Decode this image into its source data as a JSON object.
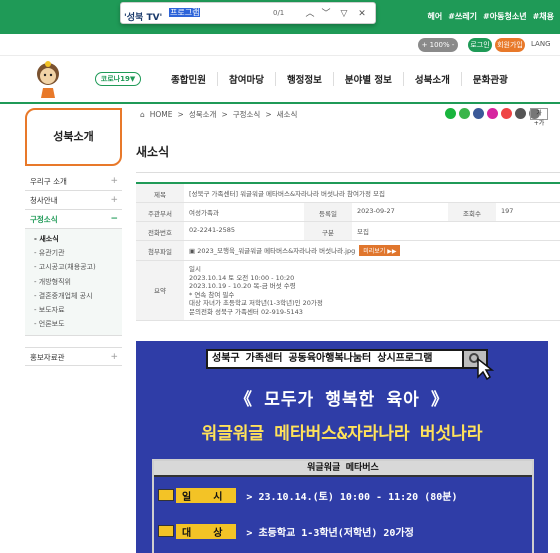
{
  "findbar": {
    "query": "프로그램",
    "count": "0/1",
    "brand": "'성북 TV'"
  },
  "topbar": {
    "tags": [
      "헤어",
      "#쓰레기",
      "#아동청소년",
      "#채용"
    ]
  },
  "subbar": {
    "zoom": "+ 100% -",
    "login": "로그인",
    "join": "회원가입",
    "lang": "LANG"
  },
  "header": {
    "corona": "코로나19▼",
    "nav": [
      "종합민원",
      "참여마당",
      "행정정보",
      "분야별 정보",
      "성북소개",
      "문화관광"
    ]
  },
  "sidebar": {
    "title": "성북소개",
    "items": [
      {
        "label": "우리구 소개",
        "mark": "+"
      },
      {
        "label": "청사안내",
        "mark": "+"
      },
      {
        "label": "구정소식",
        "mark": "−"
      }
    ],
    "sub": [
      "새소식",
      "유관기관",
      "고시공고(채용공고)",
      "개방형직위",
      "결혼중개업체 공시",
      "보도자료",
      "언론보도"
    ],
    "last": {
      "label": "홍보자료관",
      "mark": "+"
    }
  },
  "breadcrumb": [
    "HOME",
    "성북소개",
    "구정소식",
    "새소식"
  ],
  "breadcrumb_sep": ">",
  "page_title": "새소식",
  "gaga": "가+가",
  "detail": {
    "subject_label": "제목",
    "subject": "[성북구 가족센터] 워글워글 메타버스&자라나라 버섯나라 참여가정 모집",
    "dept_label": "주관부서",
    "dept": "여성가족과",
    "reg_label": "등록일",
    "reg": "2023-09-27",
    "views_label": "조회수",
    "views": "197",
    "phone_label": "전화번호",
    "phone": "02-2241-2585",
    "type_label": "구분",
    "type": "모집",
    "file_label": "첨부파일",
    "file": "2023_모행육_워글워글 메타버스&자라나라 버섯나라.jpg",
    "preview": "미리보기 ▶▶",
    "summary_label": "요약",
    "summary": [
      "일시",
      "2023.10.14 토 오전 10:00 - 10:20",
      "2023.10.19 - 10.20 목-금 버섯 수령",
      "* 연속 참여 필수",
      "대상 자녀가 초등학교 저학년(1-3학년)인 20가정",
      "문의전화  성북구 가족센터  02-919-5143"
    ]
  },
  "poster": {
    "search_text": "성북구 가족센터 공동육아행복나눔터 상시프로그램",
    "headline1": "《 모두가 행복한 육아 》",
    "headline2": "워글워글 메타버스&자라나라 버섯나라",
    "window_title": "워글워글 메타버스",
    "row1_label": "일 시",
    "row1_value": "> 23.10.14.(토) 10:00 - 11:20 (80분)",
    "row2_label": "대 상",
    "row2_value": "> 초등학교 1-3학년(저학년) 20가정"
  },
  "colors": {
    "brand_green": "#1f9a57",
    "accent_orange": "#e8792a",
    "poster_blue": "#2f3da7",
    "poster_yellow": "#ffe25a"
  }
}
